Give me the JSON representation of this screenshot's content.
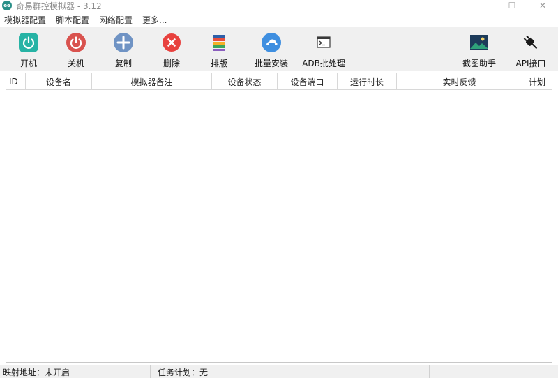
{
  "window": {
    "logo_text": "ee",
    "title": "奇易群控模拟器 - 3.12",
    "minimize": "—",
    "maximize": "☐",
    "close": "✕"
  },
  "menu": {
    "items": [
      "模拟器配置",
      "脚本配置",
      "网络配置",
      "更多..."
    ]
  },
  "toolbar": {
    "power_on": "开机",
    "power_off": "关机",
    "copy": "复制",
    "delete": "删除",
    "arrange": "排版",
    "batch_install": "批量安装",
    "adb_batch": "ADB批处理",
    "screenshot_helper": "截图助手",
    "api_interface": "API接口"
  },
  "table": {
    "columns": [
      "ID",
      "设备名",
      "模拟器备注",
      "设备状态",
      "设备端口",
      "运行时长",
      "实时反馈",
      "计划"
    ],
    "rows": []
  },
  "status": {
    "mapping_address": "映射地址：未开启",
    "task_plan": "任务计划：无"
  },
  "colors": {
    "power_on": "#27b3a5",
    "power_off": "#d9534f",
    "copy": "#6f93c4",
    "delete": "#e8413e",
    "toolbar_bg": "#f0f0f0"
  }
}
